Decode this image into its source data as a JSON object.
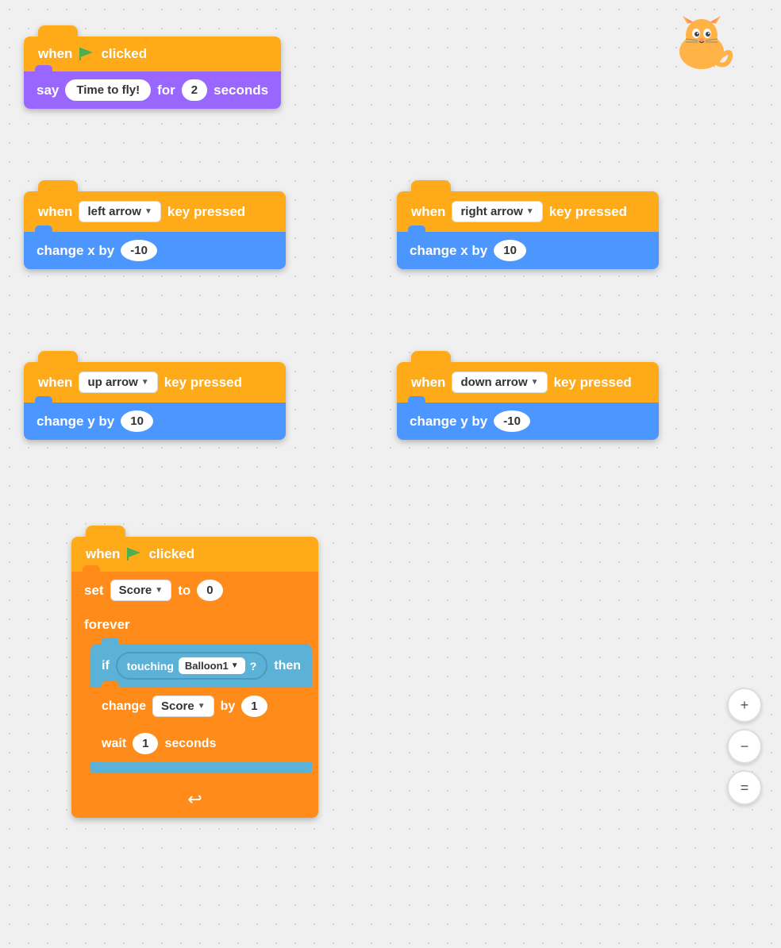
{
  "blocks": {
    "group1": {
      "hat": {
        "text_when": "when",
        "text_clicked": "clicked"
      },
      "say": {
        "text": "say",
        "message": "Time to fly!",
        "text_for": "for",
        "seconds_val": "2",
        "text_seconds": "seconds"
      }
    },
    "group2": {
      "hat": {
        "text_when": "when",
        "key": "left arrow",
        "text_pressed": "key pressed"
      },
      "action": {
        "text": "change x by",
        "value": "-10"
      }
    },
    "group3": {
      "hat": {
        "text_when": "when",
        "key": "right arrow",
        "text_pressed": "key pressed"
      },
      "action": {
        "text": "change x by",
        "value": "10"
      }
    },
    "group4": {
      "hat": {
        "text_when": "when",
        "key": "up arrow",
        "text_pressed": "key pressed"
      },
      "action": {
        "text": "change y by",
        "value": "10"
      }
    },
    "group5": {
      "hat": {
        "text_when": "when",
        "key": "down arrow",
        "text_pressed": "key pressed"
      },
      "action": {
        "text": "change y by",
        "value": "-10"
      }
    },
    "group6": {
      "hat": {
        "text_when": "when",
        "text_clicked": "clicked"
      },
      "set": {
        "text": "set",
        "variable": "Score",
        "text_to": "to",
        "value": "0"
      },
      "forever": {
        "text": "forever"
      },
      "if_block": {
        "text_if": "if",
        "text_touching": "touching",
        "variable": "Balloon1",
        "text_q": "?",
        "text_then": "then"
      },
      "change": {
        "text": "change",
        "variable": "Score",
        "text_by": "by",
        "value": "1"
      },
      "wait": {
        "text": "wait",
        "value": "1",
        "text_seconds": "seconds"
      }
    }
  },
  "zoom": {
    "zoom_in": "+",
    "zoom_out": "−",
    "fit": "="
  }
}
